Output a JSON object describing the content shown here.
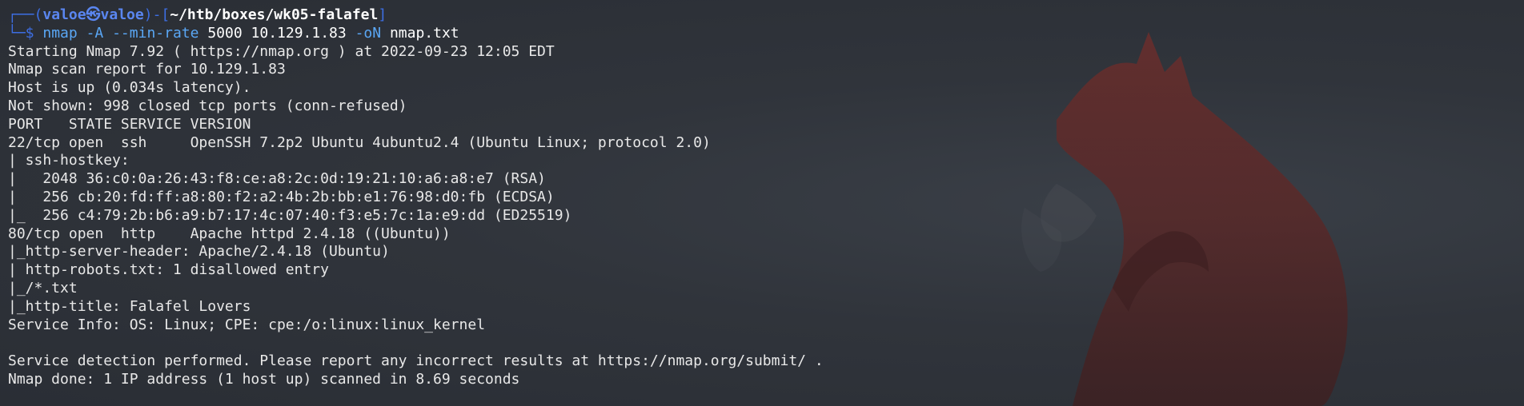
{
  "prompt": {
    "corner_top": "┌──(",
    "user": "valoe",
    "at_symbol": "㉿",
    "host": "valoe",
    "mid": ")-[",
    "path": "~/htb/boxes/wk05-falafel",
    "end": "]",
    "corner_bottom": "└─$",
    "command": "nmap",
    "flag_A": "-A",
    "flag_min_rate": "--min-rate",
    "min_rate_value": "5000",
    "target": "10.129.1.83",
    "flag_oN": "-oN",
    "outfile": "nmap.txt"
  },
  "output_lines": [
    "Starting Nmap 7.92 ( https://nmap.org ) at 2022-09-23 12:05 EDT",
    "Nmap scan report for 10.129.1.83",
    "Host is up (0.034s latency).",
    "Not shown: 998 closed tcp ports (conn-refused)",
    "PORT   STATE SERVICE VERSION",
    "22/tcp open  ssh     OpenSSH 7.2p2 Ubuntu 4ubuntu2.4 (Ubuntu Linux; protocol 2.0)",
    "| ssh-hostkey: ",
    "|   2048 36:c0:0a:26:43:f8:ce:a8:2c:0d:19:21:10:a6:a8:e7 (RSA)",
    "|   256 cb:20:fd:ff:a8:80:f2:a2:4b:2b:bb:e1:76:98:d0:fb (ECDSA)",
    "|_  256 c4:79:2b:b6:a9:b7:17:4c:07:40:f3:e5:7c:1a:e9:dd (ED25519)",
    "80/tcp open  http    Apache httpd 2.4.18 ((Ubuntu))",
    "|_http-server-header: Apache/2.4.18 (Ubuntu)",
    "| http-robots.txt: 1 disallowed entry ",
    "|_/*.txt",
    "|_http-title: Falafel Lovers",
    "Service Info: OS: Linux; CPE: cpe:/o:linux:linux_kernel",
    "",
    "Service detection performed. Please report any incorrect results at https://nmap.org/submit/ .",
    "Nmap done: 1 IP address (1 host up) scanned in 8.69 seconds"
  ],
  "colors": {
    "background": "#2b2f36",
    "prompt_blue": "#5a86f0",
    "command_blue": "#5aa7f5",
    "text": "#e8e8e8",
    "wallpaper_fox": "#5a2a2a"
  },
  "icons": {
    "wallpaper": "fox-silhouette-icon"
  }
}
